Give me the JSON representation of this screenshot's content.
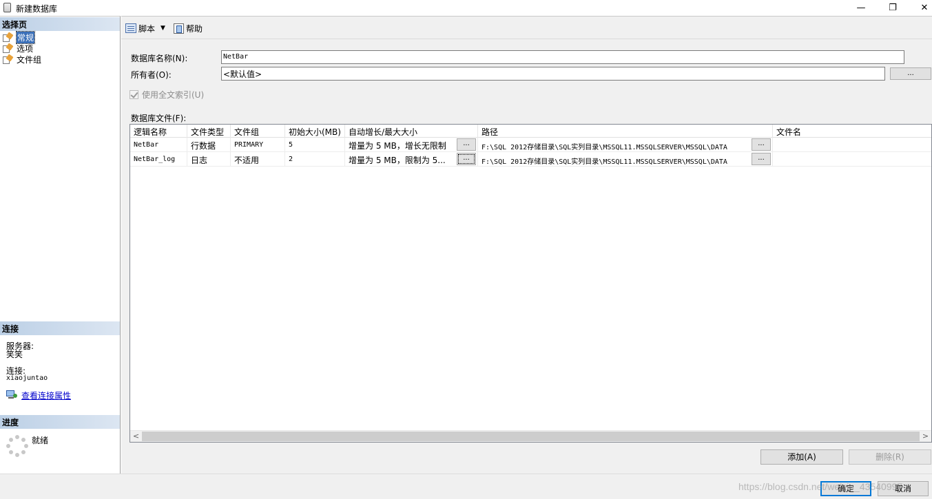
{
  "window": {
    "title": "新建数据库",
    "minimize_glyph": "—",
    "maximize_glyph": "❐",
    "close_glyph": "✕"
  },
  "left": {
    "select_page_header": "选择页",
    "pages": [
      {
        "label": "常规",
        "selected": true
      },
      {
        "label": "选项",
        "selected": false
      },
      {
        "label": "文件组",
        "selected": false
      }
    ],
    "connection_header": "连接",
    "server_label": "服务器:",
    "server_value": "笑笑",
    "connection_label": "连接:",
    "connection_value": "xiaojuntao",
    "view_props_link": "查看连接属性",
    "progress_header": "进度",
    "progress_status": "就绪"
  },
  "toolbar": {
    "script_label": "脚本",
    "help_label": "帮助"
  },
  "form": {
    "db_name_label": "数据库名称(N):",
    "db_name_value": "NetBar",
    "owner_label": "所有者(O):",
    "owner_value": "<默认值>",
    "owner_browse": "...",
    "fulltext_label": "使用全文索引(U)",
    "files_label": "数据库文件(F):"
  },
  "grid": {
    "columns": [
      "逻辑名称",
      "文件类型",
      "文件组",
      "初始大小(MB)",
      "自动增长/最大大小",
      "路径",
      "文件名"
    ],
    "rows": [
      {
        "logical": "NetBar",
        "type": "行数据",
        "filegroup": "PRIMARY",
        "size": "5",
        "growth": "增量为 5 MB，增长无限制",
        "path": "F:\\SQL 2012存储目录\\SQL实列目录\\MSSQL11.MSSQLSERVER\\MSSQL\\DATA",
        "filename": ""
      },
      {
        "logical": "NetBar_log",
        "type": "日志",
        "filegroup": "不适用",
        "size": "2",
        "growth": "增量为 5 MB，限制为 5...",
        "path": "F:\\SQL 2012存储目录\\SQL实列目录\\MSSQL11.MSSQLSERVER\\MSSQL\\DATA",
        "filename": ""
      }
    ],
    "browse": "...",
    "scroll_left": "<",
    "scroll_right": ">"
  },
  "buttons": {
    "add": "添加(A)",
    "remove": "删除(R)",
    "ok": "确定",
    "cancel": "取消"
  },
  "watermark": "https://blog.csdn.net/weixin_43540997"
}
